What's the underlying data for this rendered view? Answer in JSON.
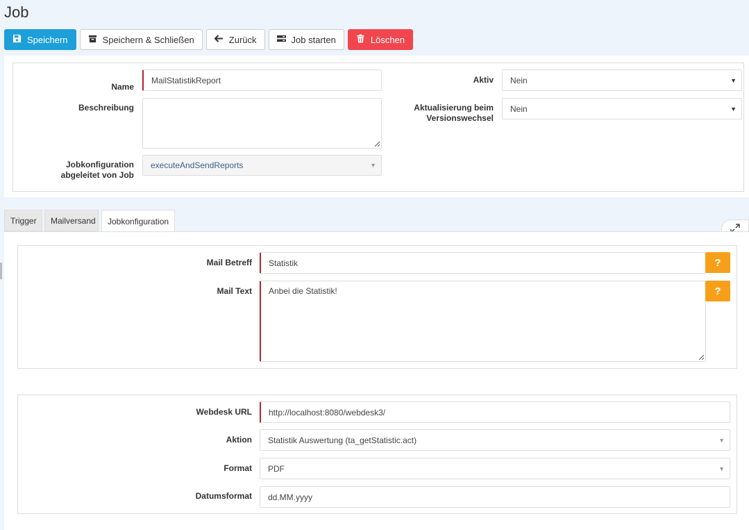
{
  "page": {
    "title": "Job"
  },
  "toolbar": {
    "save": "Speichern",
    "save_close": "Speichern & Schließen",
    "back": "Zurück",
    "start": "Job starten",
    "delete": "Löschen"
  },
  "form": {
    "name_label": "Name",
    "name_value": "MailStatistikReport",
    "description_label": "Beschreibung",
    "description_value": "",
    "jobconfig_label_1": "Jobkonfiguration",
    "jobconfig_label_2": "abgeleitet von Job",
    "jobconfig_value": "executeAndSendReports",
    "active_label": "Aktiv",
    "active_value": "Nein",
    "update_label_1": "Aktualisierung beim",
    "update_label_2": "Versionswechsel",
    "update_value": "Nein"
  },
  "tabs": [
    {
      "label": "Trigger"
    },
    {
      "label": "Mailversand"
    },
    {
      "label": "Jobkonfiguration"
    }
  ],
  "mail": {
    "subject_label": "Mail Betreff",
    "subject_value": "Statistik",
    "text_label": "Mail Text",
    "text_value": "Anbei die Statistik!",
    "help_symbol": "?"
  },
  "webdesk": {
    "url_label": "Webdesk URL",
    "url_value": "http://localhost:8080/webdesk3/",
    "action_label": "Aktion",
    "action_value": "Statistik Auswertung (ta_getStatistic.act)",
    "format_label": "Format",
    "format_value": "PDF",
    "dateformat_label": "Datumsformat",
    "dateformat_value": "dd.MM.yyyy"
  },
  "icons": {
    "save": "floppy-icon",
    "save_close": "archive-icon",
    "back": "arrow-left-icon",
    "start": "server-icon",
    "delete": "trash-icon",
    "expand": "expand-icon"
  },
  "colors": {
    "primary": "#1d9fd9",
    "danger": "#f2464f",
    "help": "#f6a01a",
    "required": "#b5222b"
  }
}
